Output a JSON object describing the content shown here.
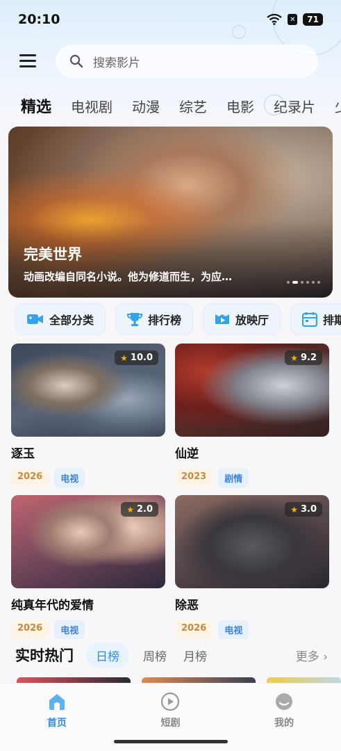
{
  "status_bar": {
    "time": "20:10",
    "battery": "71"
  },
  "search": {
    "placeholder": "搜索影片"
  },
  "category_tabs": [
    "精选",
    "电视剧",
    "动漫",
    "综艺",
    "电影",
    "纪录片",
    "少"
  ],
  "banner": {
    "title": "完美世界",
    "description": "动画改编自同名小说。他为修道而生，为应…"
  },
  "quick_links": [
    {
      "label": "全部分类",
      "icon": "video-camera-icon"
    },
    {
      "label": "排行榜",
      "icon": "trophy-icon"
    },
    {
      "label": "放映厅",
      "icon": "play-screen-icon"
    },
    {
      "label": "排期",
      "icon": "calendar-icon"
    }
  ],
  "cards": [
    {
      "title": "逐玉",
      "rating": "10.0",
      "year": "2026",
      "type": "电视"
    },
    {
      "title": "仙逆",
      "rating": "9.2",
      "year": "2023",
      "type": "剧情"
    },
    {
      "title": "纯真年代的爱情",
      "rating": "2.0",
      "year": "2026",
      "type": "电视"
    },
    {
      "title": "除恶",
      "rating": "3.0",
      "year": "2026",
      "type": "电视"
    }
  ],
  "hot": {
    "title": "实时热门",
    "tabs": [
      "日榜",
      "周榜",
      "月榜"
    ],
    "more": "更多"
  },
  "bottom_nav": [
    {
      "label": "首页",
      "icon": "home-icon"
    },
    {
      "label": "短剧",
      "icon": "play-circle-icon"
    },
    {
      "label": "我的",
      "icon": "profile-icon"
    }
  ],
  "colors": {
    "accent": "#2f8de4",
    "year_tag": "#c98a3a",
    "type_tag": "#3d84d6",
    "star": "#f5b20c"
  }
}
